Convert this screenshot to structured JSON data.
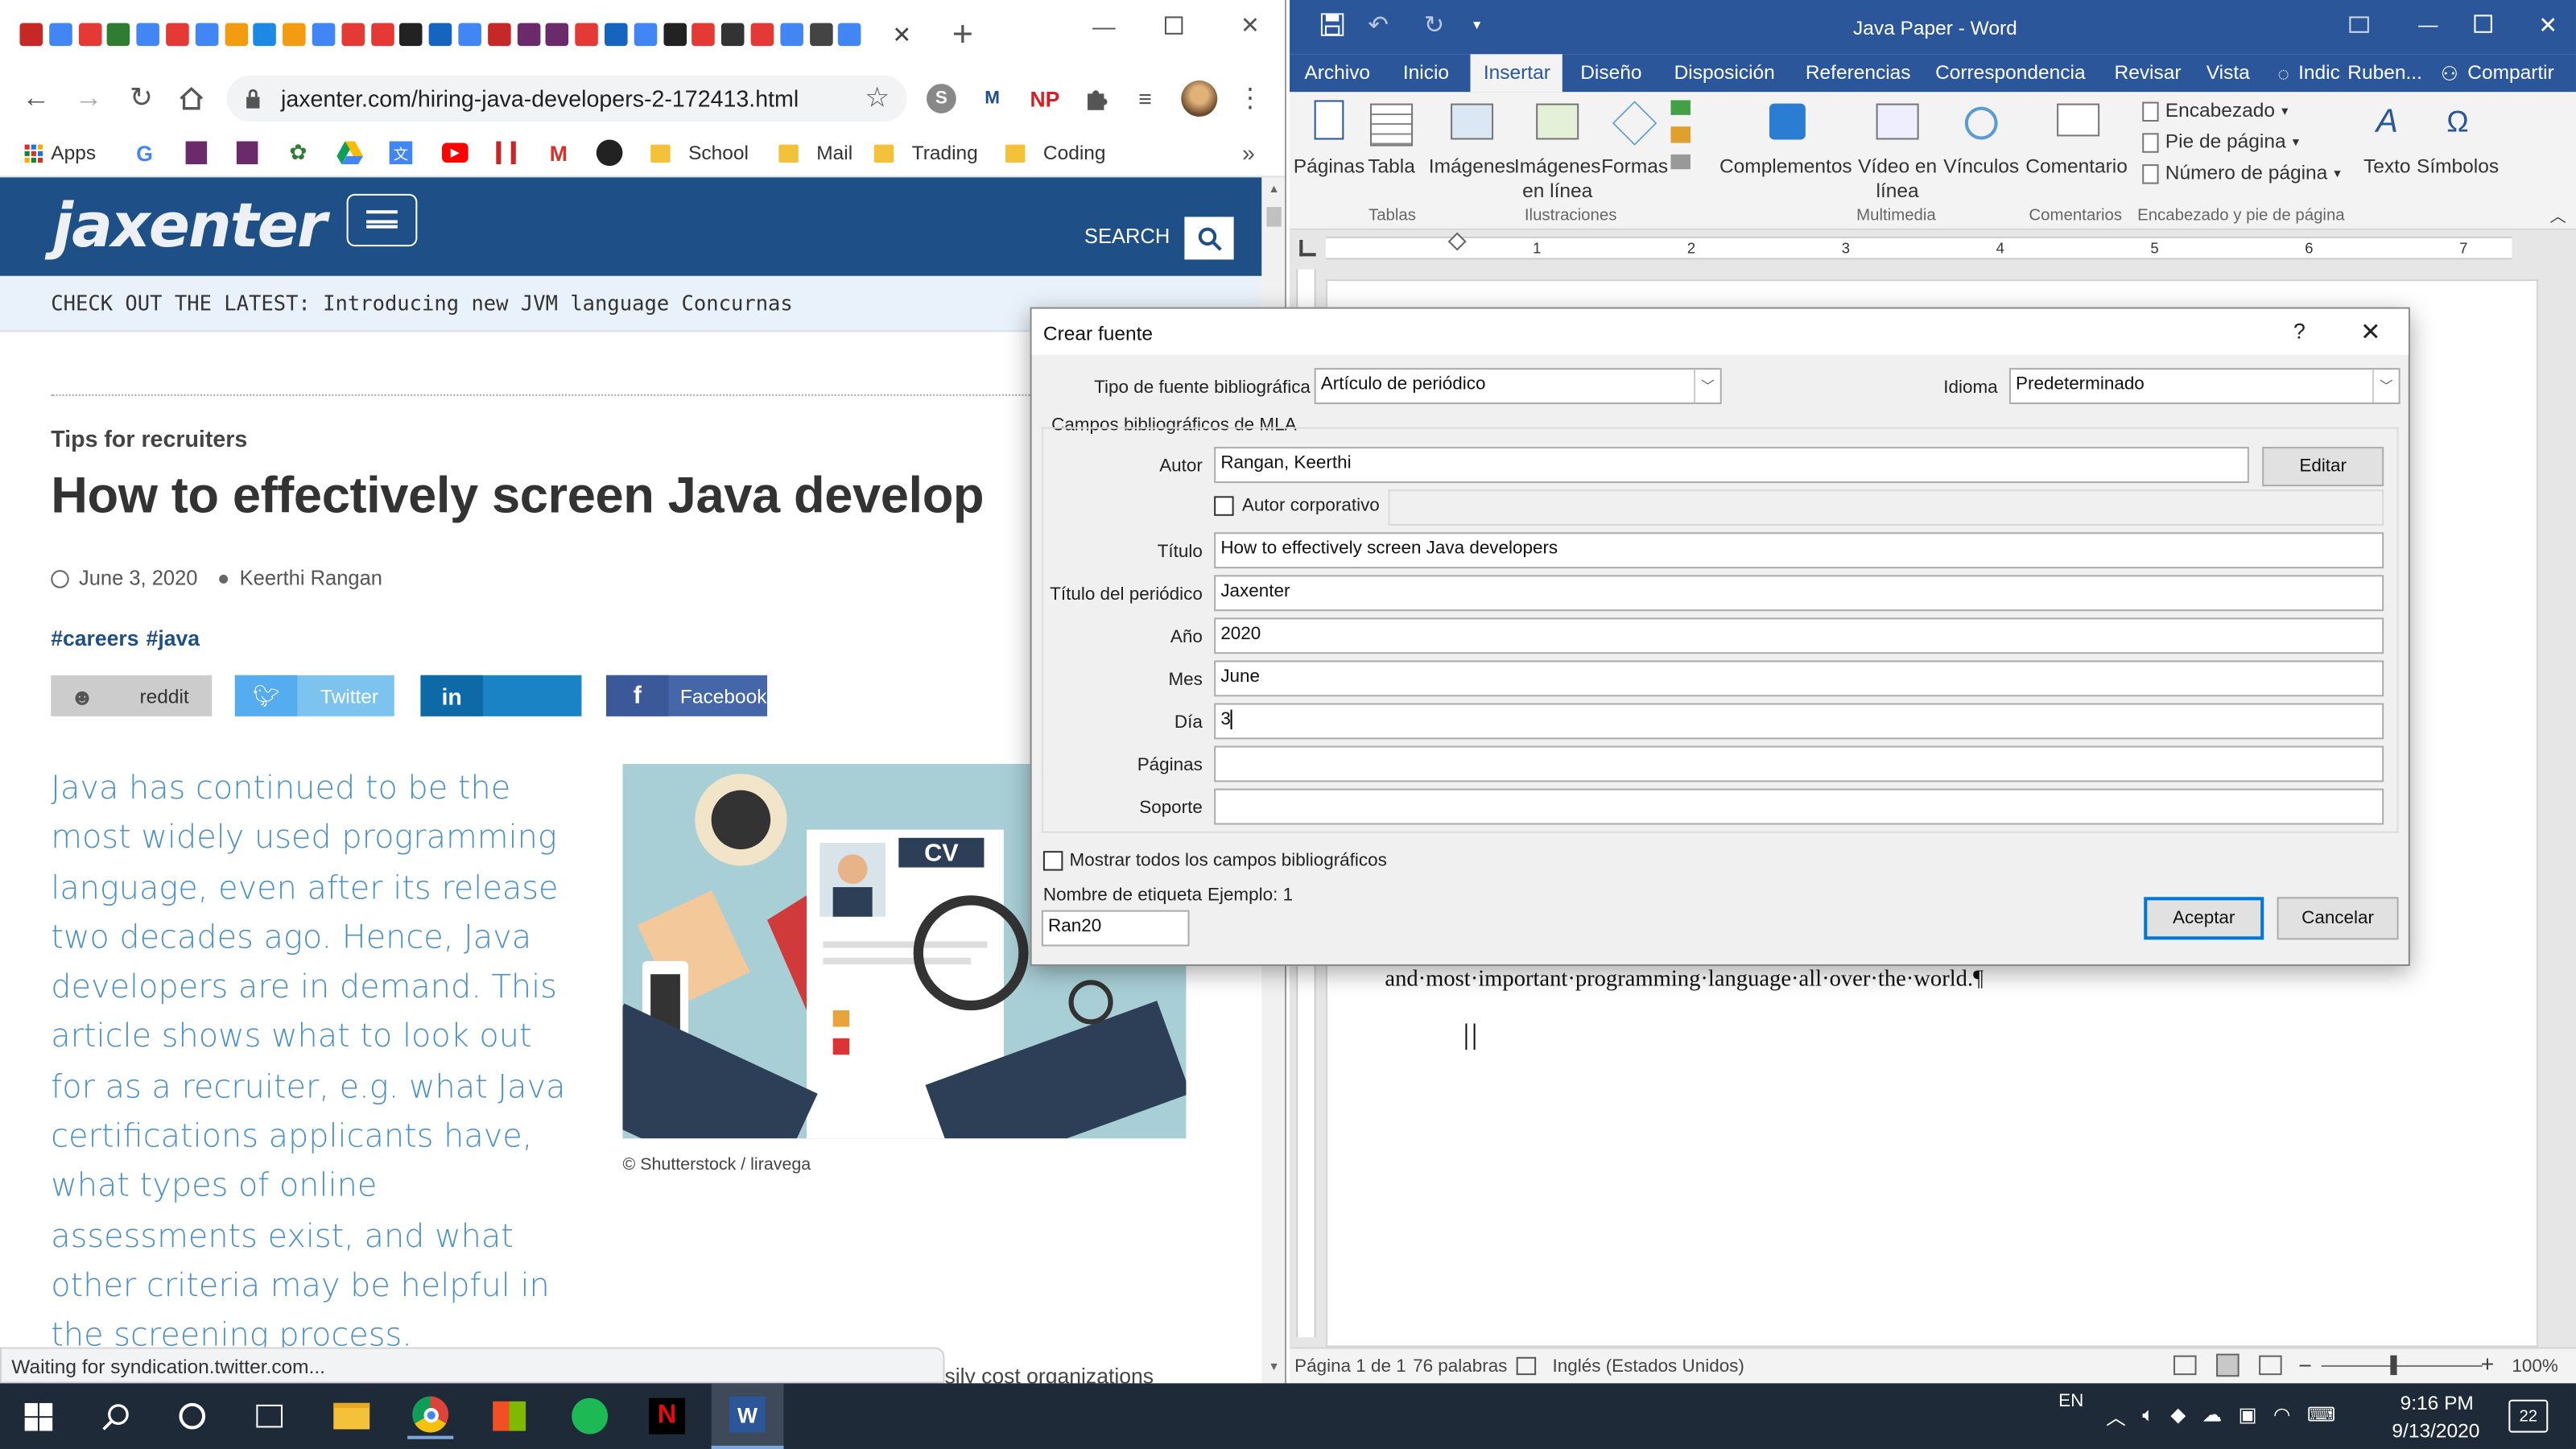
{
  "browser": {
    "url": "jaxenter.com/hiring-java-developers-2-172413.html",
    "bookmarks": [
      {
        "label": "Apps",
        "icon": "apps-grid-icon"
      },
      {
        "label": "",
        "icon": "google-icon"
      },
      {
        "label": "",
        "icon": "bookmark-icon-a"
      },
      {
        "label": "",
        "icon": "bookmark-icon-b"
      },
      {
        "label": "",
        "icon": "plant-icon"
      },
      {
        "label": "",
        "icon": "drive-icon"
      },
      {
        "label": "",
        "icon": "translate-icon"
      },
      {
        "label": "",
        "icon": "youtube-icon"
      },
      {
        "label": "",
        "icon": "library-icon"
      },
      {
        "label": "",
        "icon": "gmail-icon"
      },
      {
        "label": "",
        "icon": "github-icon"
      },
      {
        "label": "School",
        "icon": "folder-icon"
      },
      {
        "label": "Mail",
        "icon": "folder-icon"
      },
      {
        "label": "Trading",
        "icon": "folder-icon"
      },
      {
        "label": "Coding",
        "icon": "folder-icon"
      }
    ],
    "status": "Waiting for syndication.twitter.com...",
    "extensions": [
      "S",
      "M",
      "NP"
    ]
  },
  "site": {
    "logo": "jaxenter",
    "search_label": "SEARCH",
    "banner": "CHECK OUT THE LATEST: Introducing new JVM language Concurnas",
    "kicker": "Tips for recruiters",
    "headline": "How to effectively screen Java develop",
    "date": "June 3, 2020",
    "author": "Keerthi Rangan",
    "tags": [
      "#careers",
      "#java"
    ],
    "shares": [
      "reddit",
      "Twitter",
      "",
      "Facebook"
    ],
    "intro": "Java has continued to be the most widely used programming language, even after its release two decades ago. Hence, Java developers are in demand. This article shows what to look out for as a recruiter, e.g. what Java certifications applicants have, what types of online assessments exist, and what other criteria may be helpful in the screening process.",
    "image_badge": "CV",
    "caption": "© Shutterstock / liravega",
    "cutoff_text": "sily cost organizations"
  },
  "word": {
    "title": "Java Paper - Word",
    "menu": [
      "Archivo",
      "Inicio",
      "Insertar",
      "Diseño",
      "Disposición",
      "Referencias",
      "Correspondencia",
      "Revisar",
      "Vista",
      "Indic",
      "Ruben...",
      "Compartir"
    ],
    "ribbon": {
      "paginas": "Páginas",
      "tabla": "Tabla",
      "imagenes": "Imágenes",
      "imagenes_linea": "Imágenes en línea",
      "formas": "Formas",
      "complementos": "Complementos",
      "video": "Vídeo en línea",
      "vinculos": "Vínculos",
      "comentario": "Comentario",
      "encabezado": "Encabezado",
      "pie": "Pie de página",
      "numero": "Número de página",
      "texto": "Texto",
      "simbolos": "Símbolos"
    },
    "groups": [
      "Tablas",
      "Ilustraciones",
      "Multimedia",
      "Comentarios",
      "Encabezado y pie de página"
    ],
    "ruler": [
      "1",
      "2",
      "3",
      "4",
      "5",
      "6",
      "7"
    ],
    "doc_line": "and·most·important·programming·language·all·over·the·world.¶",
    "status": {
      "page": "Página 1 de 1",
      "words": "76 palabras",
      "lang": "Inglés (Estados Unidos)",
      "zoom": "100%"
    }
  },
  "dialog": {
    "title": "Crear fuente",
    "help": "?",
    "tipo_label": "Tipo de fuente bibliográfica",
    "tipo_value": "Artículo de periódico",
    "idioma_label": "Idioma",
    "idioma_value": "Predeterminado",
    "section": "Campos bibliográficos de MLA",
    "fields": [
      {
        "label": "Autor",
        "value": "Rangan, Keerthi"
      },
      {
        "label": "Título",
        "value": "How to effectively screen Java developers"
      },
      {
        "label": "Título del periódico",
        "value": "Jaxenter"
      },
      {
        "label": "Año",
        "value": "2020"
      },
      {
        "label": "Mes",
        "value": "June"
      },
      {
        "label": "Día",
        "value": "3"
      },
      {
        "label": "Páginas",
        "value": ""
      },
      {
        "label": "Soporte",
        "value": ""
      }
    ],
    "corporativo": "Autor corporativo",
    "editar": "Editar",
    "mostrar": "Mostrar todos los campos bibliográficos",
    "etiqueta_label": "Nombre de etiqueta",
    "ejemplo": "Ejemplo: 1",
    "etiqueta_value": "Ran20",
    "aceptar": "Aceptar",
    "cancelar": "Cancelar"
  },
  "taskbar": {
    "lang": "EN",
    "time": "9:16 PM",
    "date": "9/13/2020",
    "notifications": "22"
  },
  "colors": {
    "word_blue": "#2b579a",
    "jax_blue": "#1e4f86",
    "intro_blue": "#4a90c6"
  }
}
